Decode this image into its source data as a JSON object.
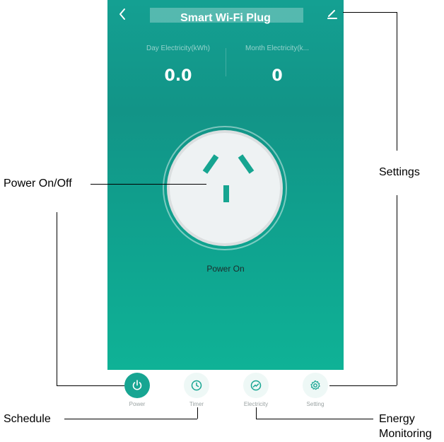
{
  "header": {
    "back_icon": "chevron-left-icon",
    "title": "Smart Wi-Fi Plug",
    "edit_icon": "pencil-icon"
  },
  "stats": {
    "day_label": "Day Electricity(kWh)",
    "day_value": "0.0",
    "month_label": "Month Electricity(k...",
    "month_value": "0"
  },
  "socket": {
    "status": "Power On"
  },
  "tabs": [
    {
      "label": "Power",
      "icon": "power-icon",
      "active": true
    },
    {
      "label": "Timer",
      "icon": "clock-icon",
      "active": false
    },
    {
      "label": "Electricity",
      "icon": "trend-icon",
      "active": false
    },
    {
      "label": "Setting",
      "icon": "gear-icon",
      "active": false
    }
  ],
  "annotations": {
    "power": "Power On/Off",
    "settings": "Settings",
    "schedule": "Schedule",
    "energy_line1": "Energy",
    "energy_line2": "Monitoring"
  },
  "colors": {
    "accent": "#17a592",
    "background_top": "#14a092",
    "background_bottom": "#0fb296"
  }
}
